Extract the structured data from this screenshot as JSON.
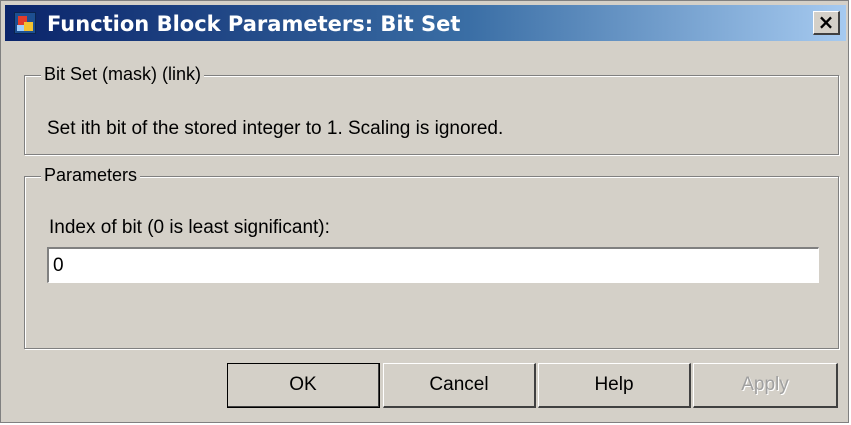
{
  "window": {
    "title": "Function Block Parameters: Bit Set",
    "close_symbol": "×",
    "icon": "simulink-block-icon"
  },
  "mask_group": {
    "legend": "Bit Set (mask) (link)",
    "description": "Set ith bit of the stored integer to 1.  Scaling is ignored."
  },
  "parameters_group": {
    "legend": "Parameters",
    "index_label": "Index of bit (0 is least significant):",
    "index_value": "0"
  },
  "buttons": {
    "ok": "OK",
    "cancel": "Cancel",
    "help": "Help",
    "apply": "Apply"
  }
}
